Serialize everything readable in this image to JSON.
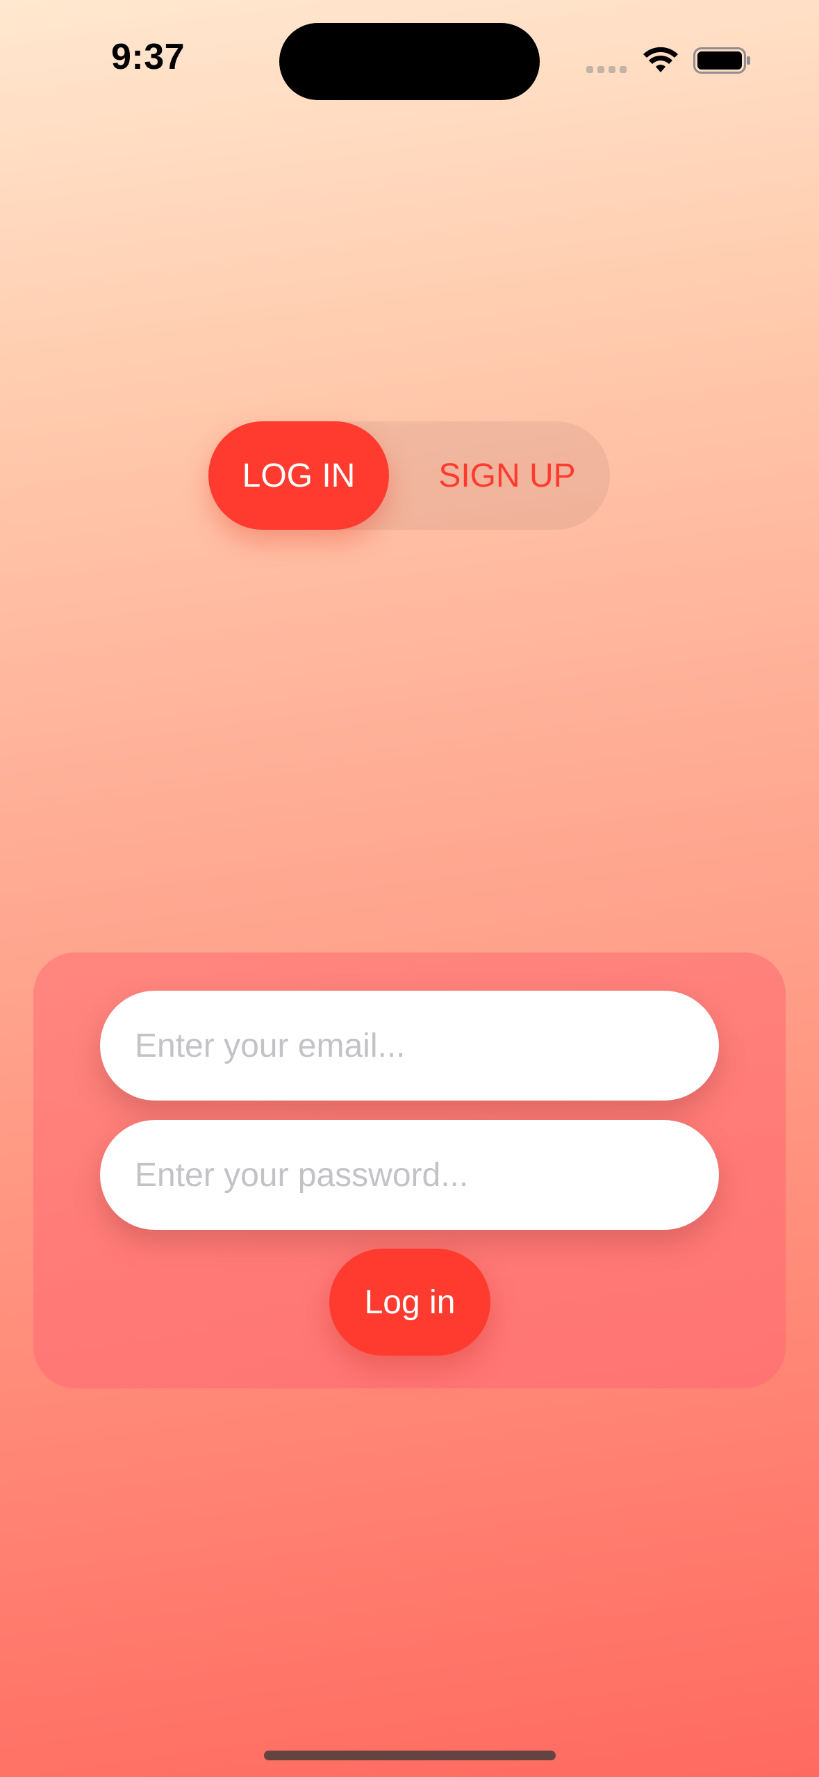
{
  "status_bar": {
    "time": "9:37",
    "icons": [
      "cellular-signal-icon",
      "wifi-icon",
      "battery-icon"
    ]
  },
  "auth_toggle": {
    "login_label": "LOG IN",
    "signup_label": "SIGN UP",
    "selected": "LOG IN"
  },
  "form": {
    "email_placeholder": "Enter your email...",
    "email_value": "",
    "password_placeholder": "Enter your password...",
    "password_value": "",
    "submit_label": "Log in"
  },
  "colors": {
    "accent": "#ff3b30",
    "background_top": "#ffe8d0",
    "background_bottom": "#ff6a60",
    "placeholder": "#c2c2c7"
  }
}
